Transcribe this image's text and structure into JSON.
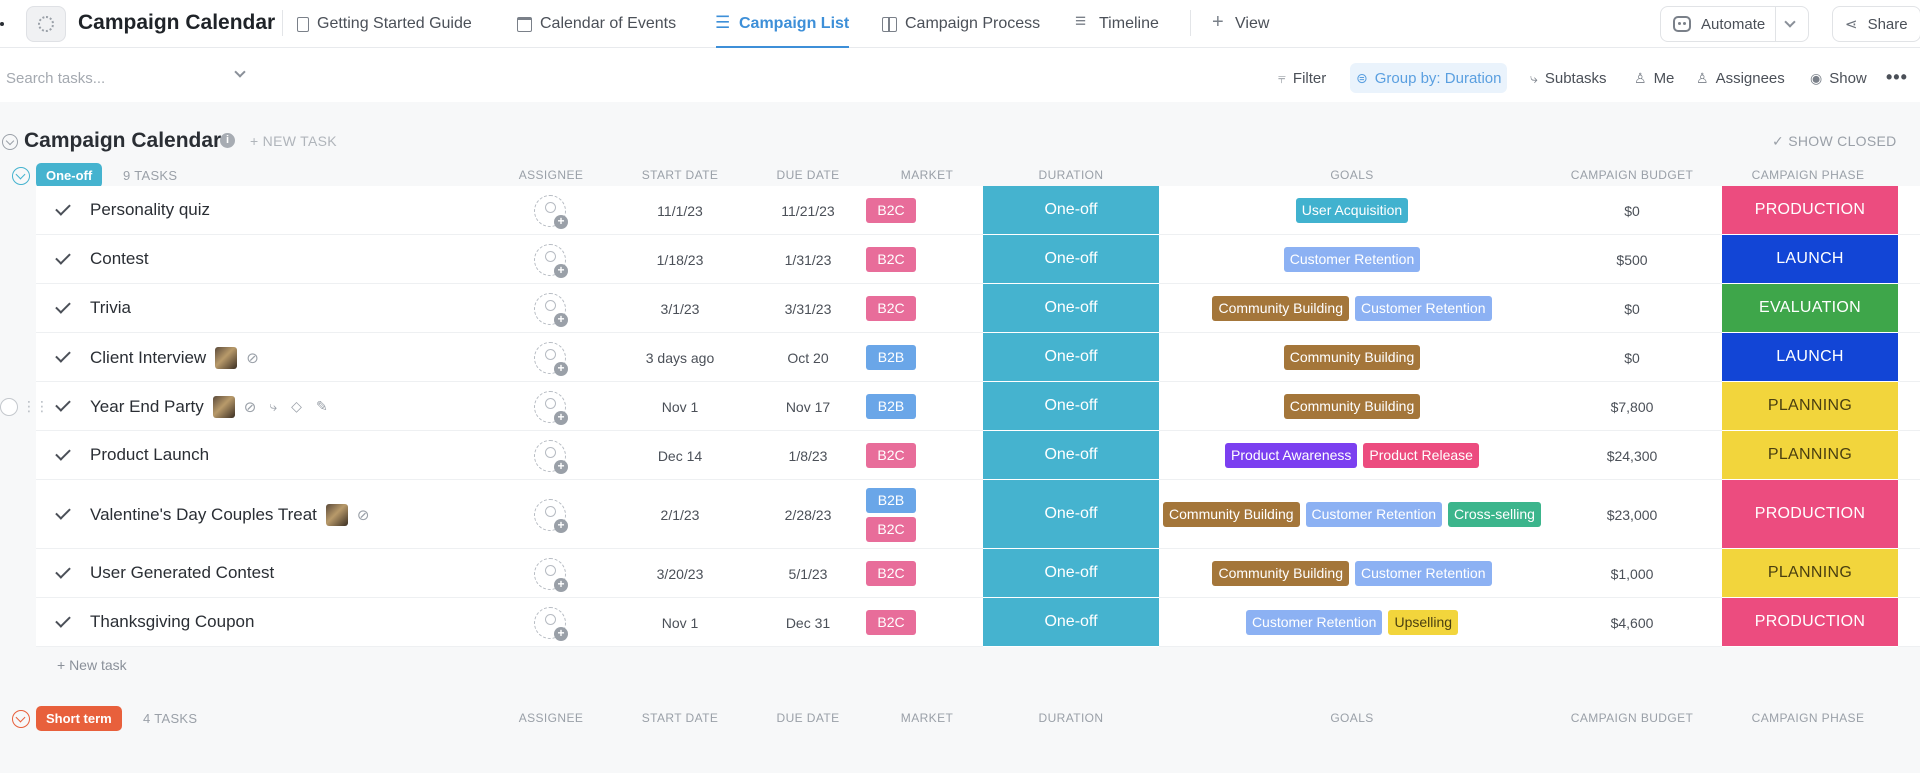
{
  "topnav": {
    "list_title": "Campaign Calendar",
    "views": [
      {
        "label": "Getting Started Guide",
        "icon": "doc-icon"
      },
      {
        "label": "Calendar of Events",
        "icon": "calendar-icon"
      },
      {
        "label": "Campaign List",
        "icon": "list-icon",
        "active": true
      },
      {
        "label": "Campaign Process",
        "icon": "board-icon"
      },
      {
        "label": "Timeline",
        "icon": "timeline-icon"
      },
      {
        "label": "View",
        "icon": "plus-icon"
      }
    ],
    "automate_label": "Automate",
    "share_label": "Share"
  },
  "toolbar": {
    "search_placeholder": "Search tasks...",
    "filter_label": "Filter",
    "group_label": "Group by: Duration",
    "subtasks_label": "Subtasks",
    "me_label": "Me",
    "assignees_label": "Assignees",
    "show_label": "Show",
    "more_label": "•••"
  },
  "list_header": {
    "title": "Campaign Calendar",
    "info_label": "i",
    "new_task_label": "+ NEW TASK",
    "show_closed_label": "✓ SHOW CLOSED"
  },
  "columns": {
    "assignee": "ASSIGNEE",
    "start_date": "START DATE",
    "due_date": "DUE DATE",
    "market": "MARKET",
    "duration": "DURATION",
    "goals": "GOALS",
    "budget": "CAMPAIGN BUDGET",
    "phase": "CAMPAIGN PHASE"
  },
  "colors": {
    "b2c": "#e86d9a",
    "b2b": "#6aa6e8",
    "duration": "#45b3cf",
    "one_off": "#45b3cf",
    "short_term": "#e8603c",
    "production": "#ec4c7f",
    "launch": "#1245d6",
    "evaluation": "#3ea64a",
    "planning": "#f2d53c",
    "user_acquisition": "#41b2cf",
    "customer_retention": "#8cb1f3",
    "community_building": "#a4763a",
    "product_awareness": "#7b3ff0",
    "product_release": "#ec4c7f",
    "cross_selling": "#3cb58c",
    "upselling": "#f2d53c"
  },
  "groups": [
    {
      "badge": "One-off",
      "count_label": "9 TASKS",
      "new_task_label": "+ New task",
      "tasks": [
        {
          "name": "Personality quiz",
          "start": "11/1/23",
          "due": "11/21/23",
          "markets": [
            "B2C"
          ],
          "duration": "One-off",
          "goals": [
            {
              "label": "User Acquisition",
              "key": "user_acquisition"
            }
          ],
          "budget": "$0",
          "phase": "PRODUCTION",
          "phase_key": "production"
        },
        {
          "name": "Contest",
          "start": "1/18/23",
          "due": "1/31/23",
          "markets": [
            "B2C"
          ],
          "duration": "One-off",
          "goals": [
            {
              "label": "Customer Retention",
              "key": "customer_retention"
            }
          ],
          "budget": "$500",
          "phase": "LAUNCH",
          "phase_key": "launch"
        },
        {
          "name": "Trivia",
          "start": "3/1/23",
          "due": "3/31/23",
          "markets": [
            "B2C"
          ],
          "duration": "One-off",
          "goals": [
            {
              "label": "Community Building",
              "key": "community_building"
            },
            {
              "label": "Customer Retention",
              "key": "customer_retention"
            }
          ],
          "budget": "$0",
          "phase": "EVALUATION",
          "phase_key": "evaluation"
        },
        {
          "name": "Client Interview",
          "start": "3 days ago",
          "due": "Oct 20",
          "markets": [
            "B2B"
          ],
          "duration": "One-off",
          "goals": [
            {
              "label": "Community Building",
              "key": "community_building"
            }
          ],
          "budget": "$0",
          "phase": "LAUNCH",
          "phase_key": "launch",
          "thumb": true,
          "clip": true
        },
        {
          "name": "Year End Party",
          "start": "Nov 1",
          "due": "Nov 17",
          "markets": [
            "B2B"
          ],
          "duration": "One-off",
          "goals": [
            {
              "label": "Community Building",
              "key": "community_building"
            }
          ],
          "budget": "$7,800",
          "phase": "PLANNING",
          "phase_key": "planning",
          "thumb": true,
          "clip": true,
          "hovered": true
        },
        {
          "name": "Product Launch",
          "start": "Dec 14",
          "due": "1/8/23",
          "markets": [
            "B2C"
          ],
          "duration": "One-off",
          "goals": [
            {
              "label": "Product Awareness",
              "key": "product_awareness"
            },
            {
              "label": "Product Release",
              "key": "product_release"
            }
          ],
          "budget": "$24,300",
          "phase": "PLANNING",
          "phase_key": "planning"
        },
        {
          "name": "Valentine's Day Couples Treat",
          "start": "2/1/23",
          "due": "2/28/23",
          "markets": [
            "B2B",
            "B2C"
          ],
          "duration": "One-off",
          "goals": [
            {
              "label": "Community Building",
              "key": "community_building"
            },
            {
              "label": "Customer Retention",
              "key": "customer_retention"
            },
            {
              "label": "Cross-selling",
              "key": "cross_selling"
            }
          ],
          "budget": "$23,000",
          "phase": "PRODUCTION",
          "phase_key": "production",
          "thumb": true,
          "clip": true,
          "tall": true
        },
        {
          "name": "User Generated Contest",
          "start": "3/20/23",
          "due": "5/1/23",
          "markets": [
            "B2C"
          ],
          "duration": "One-off",
          "goals": [
            {
              "label": "Community Building",
              "key": "community_building"
            },
            {
              "label": "Customer Retention",
              "key": "customer_retention"
            }
          ],
          "budget": "$1,000",
          "phase": "PLANNING",
          "phase_key": "planning"
        },
        {
          "name": "Thanksgiving Coupon",
          "start": "Nov 1",
          "due": "Dec 31",
          "markets": [
            "B2C"
          ],
          "duration": "One-off",
          "goals": [
            {
              "label": "Customer Retention",
              "key": "customer_retention"
            },
            {
              "label": "Upselling",
              "key": "upselling"
            }
          ],
          "budget": "$4,600",
          "phase": "PRODUCTION",
          "phase_key": "production"
        }
      ]
    },
    {
      "badge": "Short term",
      "count_label": "4 TASKS",
      "tasks": []
    }
  ]
}
